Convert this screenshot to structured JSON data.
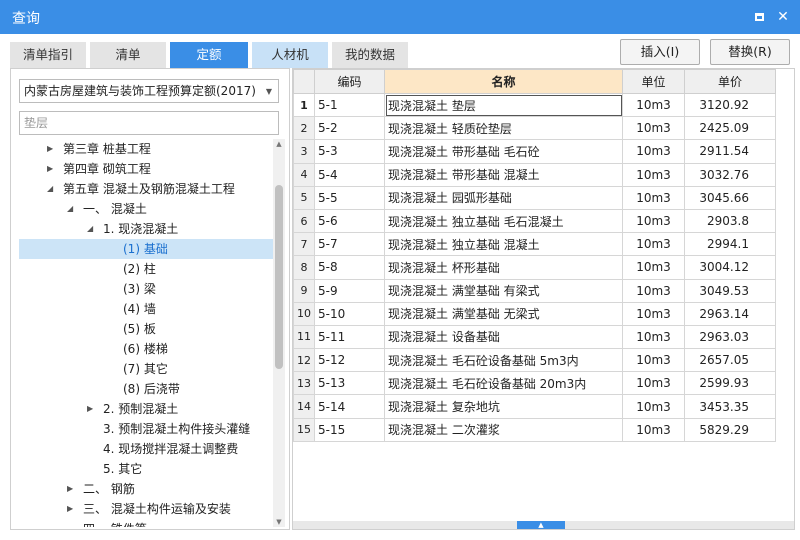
{
  "window": {
    "title": "查询"
  },
  "tabs": [
    {
      "label": "清单指引"
    },
    {
      "label": "清单"
    },
    {
      "label": "定额"
    },
    {
      "label": "人材机"
    },
    {
      "label": "我的数据"
    }
  ],
  "actions": {
    "insert_label": "插入(I)",
    "replace_label": "替换(R)"
  },
  "left": {
    "quota_library": "内蒙古房屋建筑与装饰工程预算定额(2017)",
    "search_value": "垫层"
  },
  "tree": [
    {
      "label": "第三章 桩基工程",
      "arrow": "▶"
    },
    {
      "label": "第四章 砌筑工程",
      "arrow": "▶"
    },
    {
      "label": "第五章 混凝土及钢筋混凝土工程",
      "arrow": "◢"
    },
    {
      "label": "一、 混凝土",
      "arrow": "◢"
    },
    {
      "label": "1. 现浇混凝土",
      "arrow": "◢"
    },
    {
      "label": "(1) 基础",
      "arrow": ""
    },
    {
      "label": "(2) 柱",
      "arrow": ""
    },
    {
      "label": "(3) 梁",
      "arrow": ""
    },
    {
      "label": "(4) 墙",
      "arrow": ""
    },
    {
      "label": "(5) 板",
      "arrow": ""
    },
    {
      "label": "(6) 楼梯",
      "arrow": ""
    },
    {
      "label": "(7) 其它",
      "arrow": ""
    },
    {
      "label": "(8) 后浇带",
      "arrow": ""
    },
    {
      "label": "2. 预制混凝土",
      "arrow": "▶"
    },
    {
      "label": "3. 预制混凝土构件接头灌缝",
      "arrow": ""
    },
    {
      "label": "4. 现场搅拌混凝土调整费",
      "arrow": ""
    },
    {
      "label": "5. 其它",
      "arrow": ""
    },
    {
      "label": "二、 钢筋",
      "arrow": "▶"
    },
    {
      "label": "三、 混凝土构件运输及安装",
      "arrow": "▶"
    },
    {
      "label": "四、 铁件等",
      "arrow": ""
    }
  ],
  "table": {
    "headers": [
      "",
      "编码",
      "名称",
      "单位",
      "单价"
    ],
    "rows": [
      {
        "n": "1",
        "code": "5-1",
        "name": "现浇混凝土 垫层",
        "unit": "10m3",
        "price": "3120.92"
      },
      {
        "n": "2",
        "code": "5-2",
        "name": "现浇混凝土 轻质砼垫层",
        "unit": "10m3",
        "price": "2425.09"
      },
      {
        "n": "3",
        "code": "5-3",
        "name": "现浇混凝土 带形基础 毛石砼",
        "unit": "10m3",
        "price": "2911.54"
      },
      {
        "n": "4",
        "code": "5-4",
        "name": "现浇混凝土 带形基础 混凝土",
        "unit": "10m3",
        "price": "3032.76"
      },
      {
        "n": "5",
        "code": "5-5",
        "name": "现浇混凝土 园弧形基础",
        "unit": "10m3",
        "price": "3045.66"
      },
      {
        "n": "6",
        "code": "5-6",
        "name": "现浇混凝土 独立基础 毛石混凝土",
        "unit": "10m3",
        "price": "2903.8"
      },
      {
        "n": "7",
        "code": "5-7",
        "name": "现浇混凝土 独立基础 混凝土",
        "unit": "10m3",
        "price": "2994.1"
      },
      {
        "n": "8",
        "code": "5-8",
        "name": "现浇混凝土 杯形基础",
        "unit": "10m3",
        "price": "3004.12"
      },
      {
        "n": "9",
        "code": "5-9",
        "name": "现浇混凝土 满堂基础 有梁式",
        "unit": "10m3",
        "price": "3049.53"
      },
      {
        "n": "10",
        "code": "5-10",
        "name": "现浇混凝土 满堂基础 无梁式",
        "unit": "10m3",
        "price": "2963.14"
      },
      {
        "n": "11",
        "code": "5-11",
        "name": "现浇混凝土 设备基础",
        "unit": "10m3",
        "price": "2963.03"
      },
      {
        "n": "12",
        "code": "5-12",
        "name": "现浇混凝土 毛石砼设备基础 5m3内",
        "unit": "10m3",
        "price": "2657.05"
      },
      {
        "n": "13",
        "code": "5-13",
        "name": "现浇混凝土 毛石砼设备基础 20m3内",
        "unit": "10m3",
        "price": "2599.93"
      },
      {
        "n": "14",
        "code": "5-14",
        "name": "现浇混凝土 复杂地坑",
        "unit": "10m3",
        "price": "3453.35"
      },
      {
        "n": "15",
        "code": "5-15",
        "name": "现浇混凝土 二次灌浆",
        "unit": "10m3",
        "price": "5829.29"
      }
    ]
  },
  "colors": {
    "accent": "#3a8ee6",
    "selected_row": "#cce4f7",
    "name_header": "#fde7c6"
  }
}
